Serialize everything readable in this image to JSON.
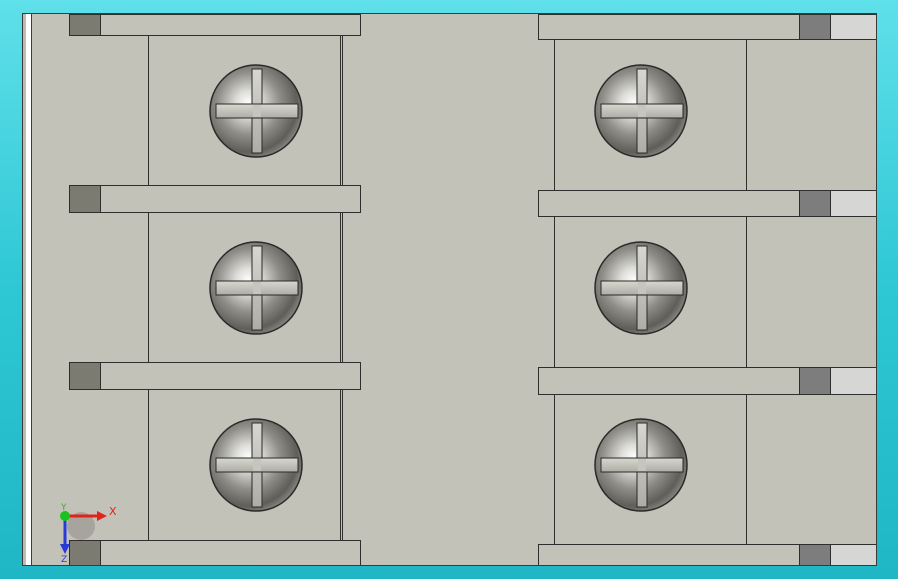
{
  "viewport": {
    "background": "#c3c2b9",
    "frame_background": "#2ec7d4"
  },
  "model": {
    "left_terminals": 3,
    "right_terminals": 3,
    "screw_type": "phillips-pan-head",
    "screw_color": "#8a8a84"
  },
  "triad": {
    "x_label": "X",
    "y_label": "Y",
    "z_label": "Z",
    "x_color": "#e0241b",
    "y_color": "#19c21f",
    "z_color": "#2a3ad6"
  }
}
